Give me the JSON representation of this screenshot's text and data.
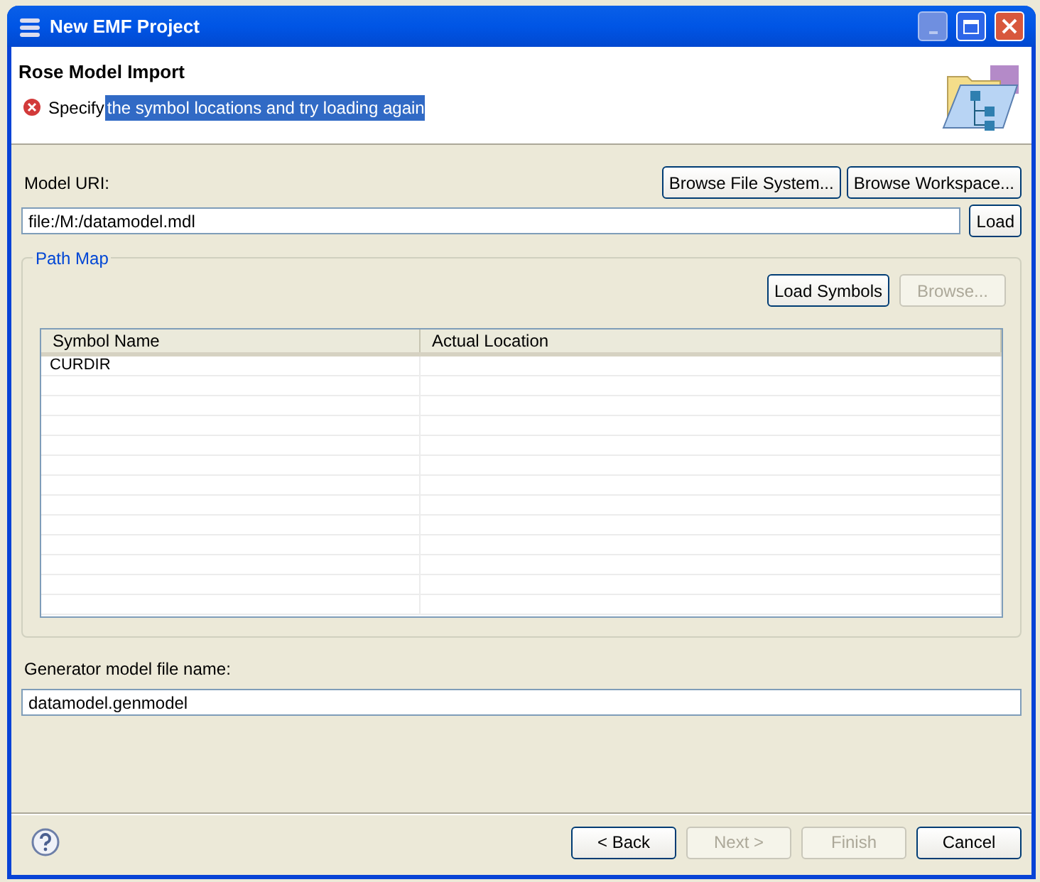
{
  "window": {
    "title": "New EMF Project"
  },
  "header": {
    "title": "Rose Model Import",
    "message": {
      "kind": "error",
      "text": "Specify",
      "selected_text": "the symbol locations and try loading again"
    }
  },
  "model_uri": {
    "label": "Model URI:",
    "buttons": [
      {
        "label": "Browse File System...",
        "disabled": false
      },
      {
        "label": "Browse Workspace...",
        "disabled": false
      }
    ],
    "value": "file:/M:/datamodel.mdl",
    "load_button": {
      "label": "Load",
      "disabled": false
    }
  },
  "path_map": {
    "title": "Path Map",
    "buttons": [
      {
        "label": "Load Symbols",
        "disabled": false
      },
      {
        "label": "Browse...",
        "disabled": true
      }
    ],
    "table": {
      "columns": [
        "Symbol Name",
        "Actual Location"
      ],
      "rows": [
        [
          "CURDIR",
          ""
        ]
      ]
    }
  },
  "generator": {
    "label": "Generator model file name:",
    "value": "datamodel.genmodel"
  },
  "footer": {
    "buttons": [
      {
        "label": "< Back",
        "disabled": false
      },
      {
        "label": "Next >",
        "disabled": true
      },
      {
        "label": "Finish",
        "disabled": true
      },
      {
        "label": "Cancel",
        "disabled": false
      }
    ]
  }
}
